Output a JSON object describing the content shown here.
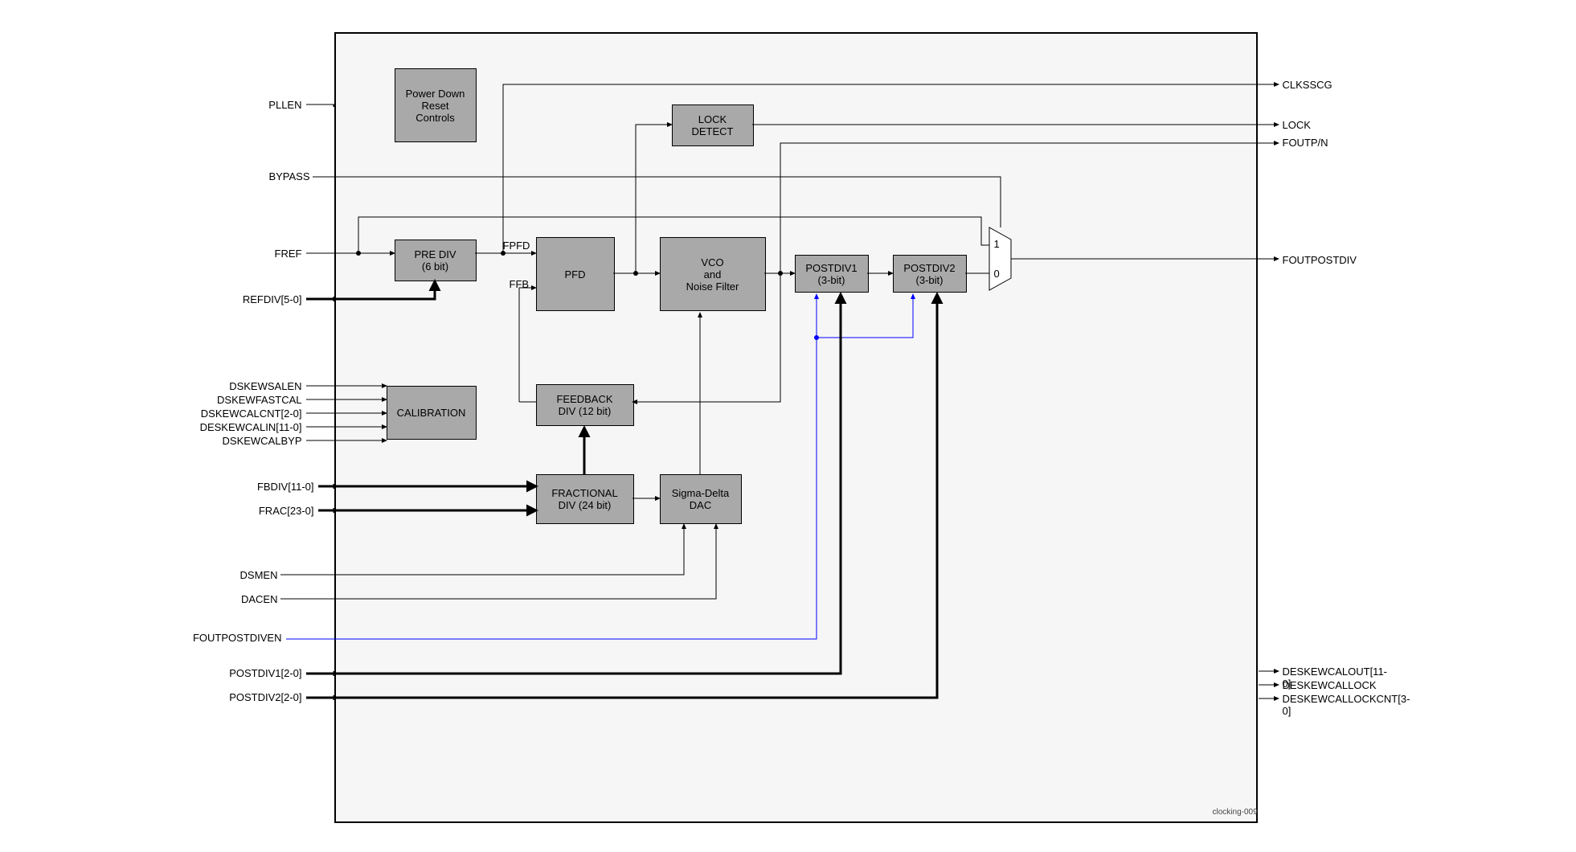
{
  "blocks": {
    "powerdown": {
      "line1": "Power Down",
      "line2": "Reset",
      "line3": "Controls"
    },
    "prediv": {
      "line1": "PRE DIV",
      "line2": "(6 bit)"
    },
    "pfd": {
      "line1": "PFD"
    },
    "lockdetect": {
      "line1": "LOCK",
      "line2": "DETECT"
    },
    "vco": {
      "line1": "VCO",
      "line2": "and",
      "line3": "Noise Filter"
    },
    "postdiv1": {
      "line1": "POSTDIV1",
      "line2": "(3-bit)"
    },
    "postdiv2": {
      "line1": "POSTDIV2",
      "line2": "(3-bit)"
    },
    "calibration": {
      "line1": "CALIBRATION"
    },
    "feedback": {
      "line1": "FEEDBACK",
      "line2": "DIV (12 bit)"
    },
    "fracdiv": {
      "line1": "FRACTIONAL",
      "line2": "DIV (24 bit)"
    },
    "sigmadelta": {
      "line1": "Sigma-Delta",
      "line2": "DAC"
    }
  },
  "inputs": {
    "pllen": "PLLEN",
    "bypass": "BYPASS",
    "fref": "FREF",
    "refdiv": "REFDIV[5-0]",
    "dskewsalen": "DSKEWSALEN",
    "dskewfastcal": "DSKEWFASTCAL",
    "dskewcalcnt": "DSKEWCALCNT[2-0]",
    "deskewcalin": "DESKEWCALIN[11-0]",
    "dskewcalbyp": "DSKEWCALBYP",
    "fbdiv": "FBDIV[11-0]",
    "frac": "FRAC[23-0]",
    "dsmen": "DSMEN",
    "dacen": "DACEN",
    "foutpostdiven": "FOUTPOSTDIVEN",
    "postdiv1": "POSTDIV1[2-0]",
    "postdiv2": "POSTDIV2[2-0]"
  },
  "outputs": {
    "clksscg": "CLKSSCG",
    "lock": "LOCK",
    "foutpn": "FOUTP/N",
    "foutpostdiv": "FOUTPOSTDIV",
    "deskewcalout": "DESKEWCALOUT[11-0]",
    "deskewcallock": "DESKEWCALLOCK",
    "deskewcallockcnt": "DESKEWCALLOCKCNT[3-0]"
  },
  "mux": {
    "top": "1",
    "bottom": "0"
  },
  "wirelabels": {
    "fpfd": "FPFD",
    "ffb": "FFB"
  },
  "footer_id": "clocking-009"
}
